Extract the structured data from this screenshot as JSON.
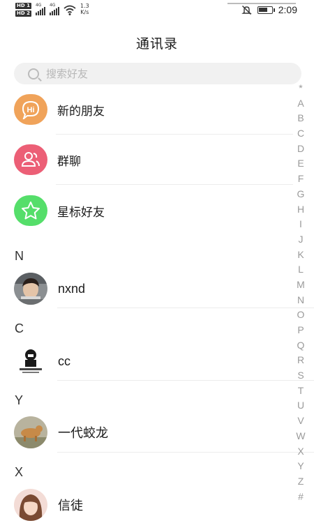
{
  "status_bar": {
    "hd1": "HD 1",
    "hd2": "HD 2",
    "net1": "4G",
    "net2": "4G",
    "speed_value": "1.3",
    "speed_unit": "K/s",
    "time": "2:09",
    "battery_level": 0.7,
    "icons": [
      "signal-icon",
      "wifi-icon",
      "bell-muted-icon",
      "battery-icon"
    ]
  },
  "header": {
    "title": "通讯录"
  },
  "search": {
    "placeholder": "搜索好友"
  },
  "functions": [
    {
      "label": "新的朋友",
      "icon": "new-friends-icon",
      "color": "#f0a35a"
    },
    {
      "label": "群聊",
      "icon": "group-chat-icon",
      "color": "#ec5f76"
    },
    {
      "label": "星标好友",
      "icon": "star-icon",
      "color": "#55de6a"
    }
  ],
  "sections": [
    {
      "letter": "N",
      "contacts": [
        {
          "name": "nxnd"
        }
      ]
    },
    {
      "letter": "C",
      "contacts": [
        {
          "name": "cc"
        }
      ]
    },
    {
      "letter": "Y",
      "contacts": [
        {
          "name": "一代蛟龙"
        }
      ]
    },
    {
      "letter": "X",
      "contacts": [
        {
          "name": "信徒"
        }
      ]
    }
  ],
  "index": [
    "*",
    "A",
    "B",
    "C",
    "D",
    "E",
    "F",
    "G",
    "H",
    "I",
    "J",
    "K",
    "L",
    "M",
    "N",
    "O",
    "P",
    "Q",
    "R",
    "S",
    "T",
    "U",
    "V",
    "W",
    "X",
    "Y",
    "Z",
    "#"
  ]
}
